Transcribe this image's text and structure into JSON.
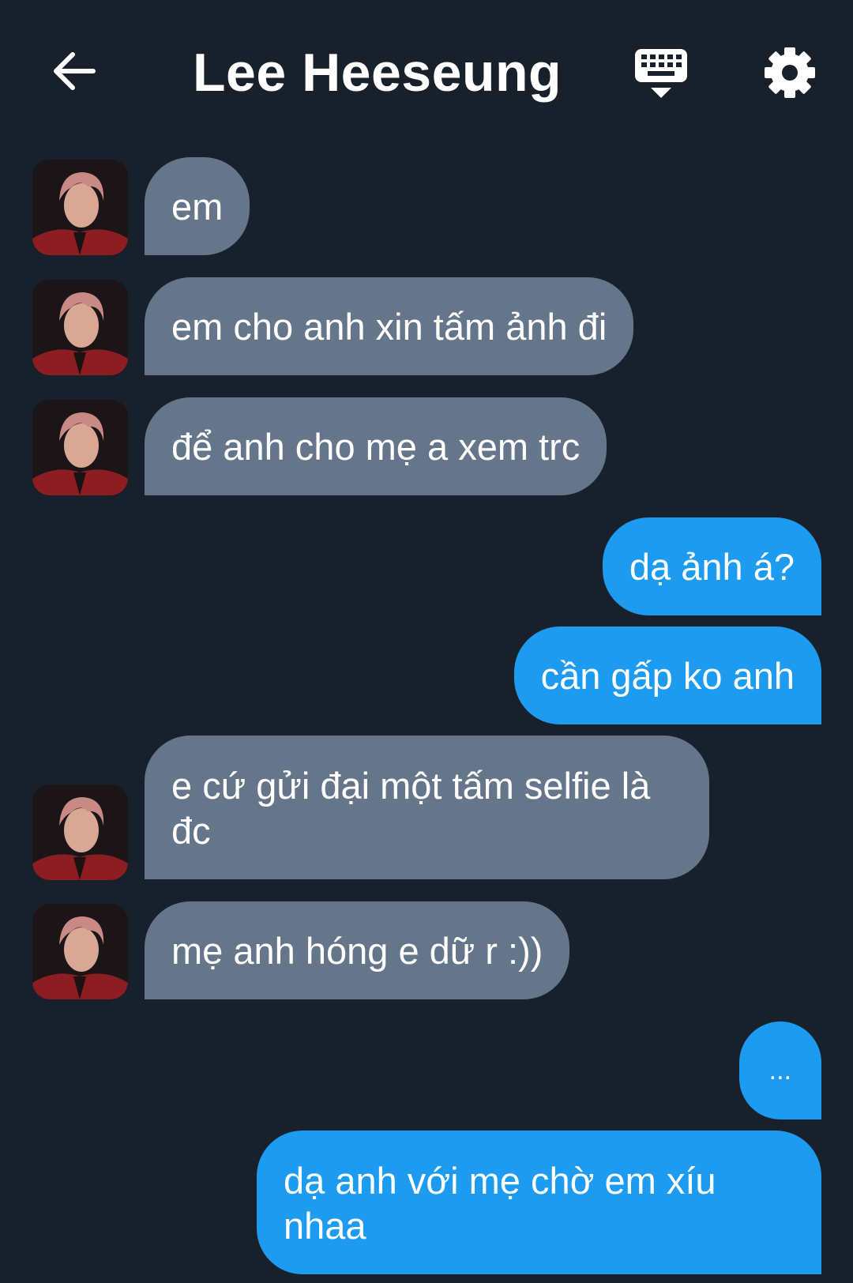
{
  "header": {
    "title": "Lee Heeseung",
    "back_icon": "arrow-left-icon",
    "keyboard_icon": "keyboard-hide-icon",
    "settings_icon": "gear-icon"
  },
  "colors": {
    "background": "#17202b",
    "incoming_bubble": "#66768a",
    "outgoing_bubble": "#1d9bf0",
    "text": "#ffffff"
  },
  "messages": [
    {
      "sender": "contact",
      "text": "em"
    },
    {
      "sender": "contact",
      "text": "em cho anh xin tấm ảnh đi"
    },
    {
      "sender": "contact",
      "text": "để anh cho mẹ a xem trc"
    },
    {
      "sender": "me",
      "text": "dạ ảnh á?"
    },
    {
      "sender": "me",
      "text": "cần gấp ko anh"
    },
    {
      "sender": "contact",
      "text": "e cứ gửi đại một tấm selfie là đc"
    },
    {
      "sender": "contact",
      "text": "mẹ anh hóng e dữ r :))"
    },
    {
      "sender": "me",
      "text": "..."
    },
    {
      "sender": "me",
      "text": "dạ anh với mẹ chờ em xíu nhaa"
    }
  ]
}
